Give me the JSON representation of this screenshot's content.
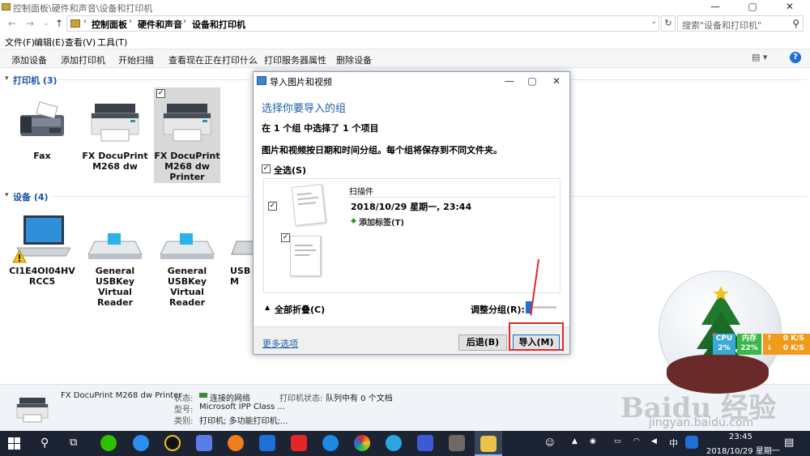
{
  "window": {
    "title": "控制面板\\硬件和声音\\设备和打印机",
    "controls": [
      "—",
      "▢",
      "✕"
    ]
  },
  "nav": {
    "breadcrumb": [
      "控制面板",
      "硬件和声音",
      "设备和打印机"
    ],
    "search_placeholder": "搜索\"设备和打印机\""
  },
  "menu": [
    "文件(F)",
    "编辑(E)",
    "查看(V)",
    "工具(T)"
  ],
  "commands": [
    "添加设备",
    "添加打印机",
    "开始扫描",
    "查看现在正在打印什么",
    "打印服务器属性",
    "删除设备"
  ],
  "printers": {
    "header": "打印机 (3)",
    "items": [
      {
        "label": "Fax"
      },
      {
        "label": "FX DocuPrint M268 dw"
      },
      {
        "label": "FX DocuPrint M268 dw Printer"
      }
    ]
  },
  "devices": {
    "header": "设备 (4)",
    "items": [
      {
        "label": "CI1E4OI04HV RCC5"
      },
      {
        "label": "General USBKey Virtual Reader"
      },
      {
        "label": "General USBKey Virtual Reader"
      },
      {
        "label": "USB M"
      }
    ]
  },
  "details": {
    "name": "FX DocuPrint M268 dw Printer",
    "status_label": "状态:",
    "status_value": "连接的网络",
    "model_label": "型号:",
    "model_value": "Microsoft IPP Class ...",
    "category_label": "类别:",
    "category_value": "打印机; 多功能打印机;...",
    "printer_status_label": "打印机状态:",
    "printer_status_value": "队列中有 0 个文档"
  },
  "dialog": {
    "title": "导入图片和视频",
    "heading": "选择你要导入的组",
    "count_text": "在 1 个组 中选择了 1 个项目",
    "description": "图片和视频按日期和时间分组。每个组将保存到不同文件夹。",
    "select_all": "全选(S)",
    "group": {
      "name": "扫描件",
      "datetime": "2018/10/29 星期一, 23:44",
      "add_tag": "添加标签(T)"
    },
    "collapse_all": "全部折叠(C)",
    "adjust_grouping": "调整分组(R):",
    "more_options": "更多选项",
    "back_button": "后退(B)",
    "import_button": "导入(M)"
  },
  "widget": {
    "cpu_label": "CPU",
    "cpu_value": "2%",
    "mem_label": "内存",
    "mem_value": "22%",
    "up_speed": "0 K/S",
    "down_speed": "0 K/S"
  },
  "watermark": {
    "brand": "Baidu 经验",
    "url": "jingyan.baidu.com"
  },
  "taskbar": {
    "ime": "中",
    "time": "23:45",
    "date": "2018/10/29 星期一"
  },
  "colors": {
    "accent_blue": "#1e5fa8",
    "highlight_red": "#e3262a",
    "taskbar": "#1c2433"
  }
}
